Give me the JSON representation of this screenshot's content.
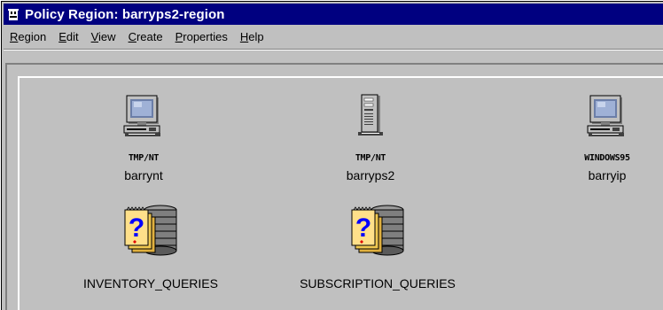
{
  "window": {
    "title": "Policy Region: barryps2-region"
  },
  "menu": [
    {
      "label": "Region",
      "underline": "R",
      "rest": "egion"
    },
    {
      "label": "Edit",
      "underline": "E",
      "rest": "dit"
    },
    {
      "label": "View",
      "underline": "V",
      "rest": "iew"
    },
    {
      "label": "Create",
      "underline": "C",
      "rest": "reate"
    },
    {
      "label": "Properties",
      "underline": "P",
      "rest": "roperties"
    },
    {
      "label": "Help",
      "underline": "H",
      "rest": "elp"
    }
  ],
  "items": [
    {
      "caption": "TMP/NT",
      "label": "barrynt",
      "icon": "desktop-computer-icon"
    },
    {
      "caption": "TMP/NT",
      "label": "barryps2",
      "icon": "server-tower-icon"
    },
    {
      "caption": "WINDOWS95",
      "label": "barryip",
      "icon": "desktop-computer-icon"
    },
    {
      "label": "INVENTORY_QUERIES",
      "icon": "query-library-icon"
    },
    {
      "label": "SUBSCRIPTION_QUERIES",
      "icon": "query-library-icon"
    }
  ],
  "colors": {
    "titlebar": "#000080",
    "face": "#c0c0c0",
    "question": "#0000ff",
    "notes": "#ffe08a"
  }
}
